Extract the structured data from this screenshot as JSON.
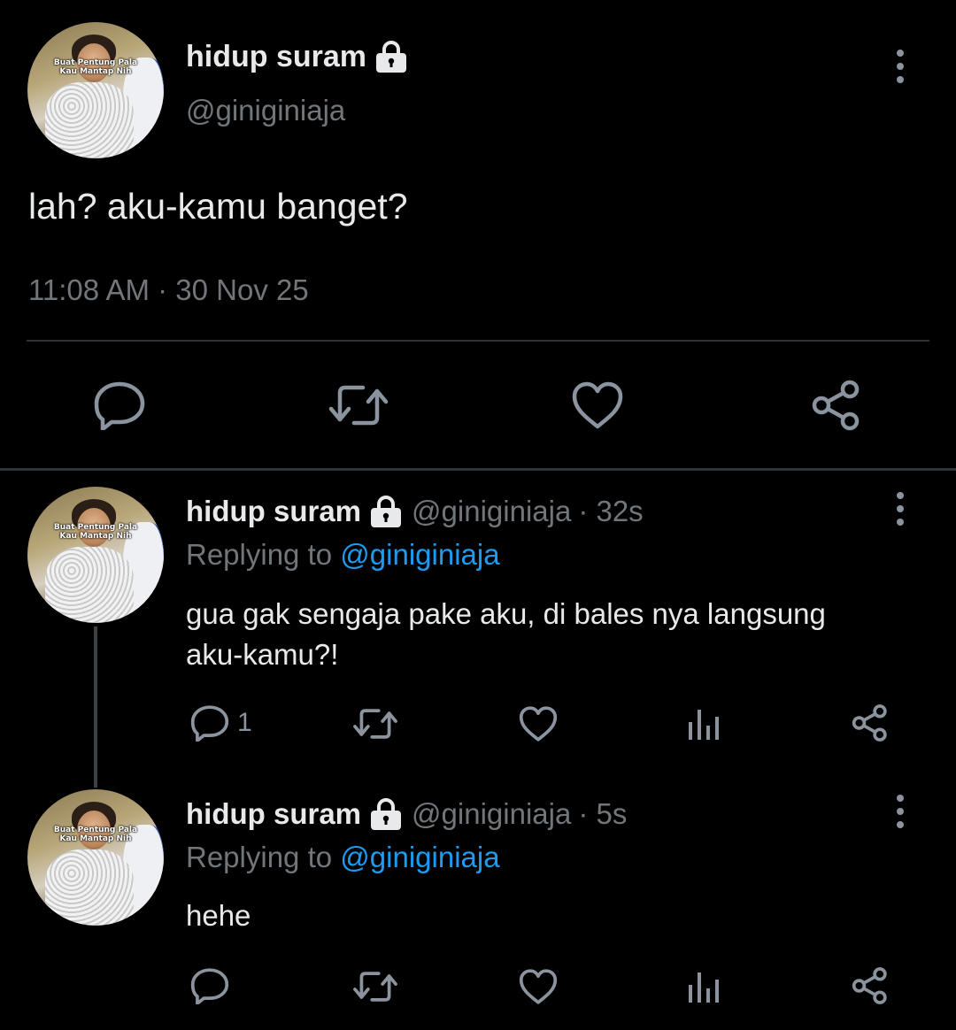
{
  "main_tweet": {
    "display_name": "hidup suram",
    "handle": "@giniginiaja",
    "text": "lah? aku-kamu banget?",
    "timestamp": "11:08 AM · 30 Nov 25",
    "avatar_caption_1": "Buat Pentung Pala",
    "avatar_caption_2": "Kau Mantap Nih",
    "actions": [
      "reply-icon",
      "retweet-icon",
      "like-icon",
      "share-icon"
    ]
  },
  "replies": [
    {
      "display_name": "hidup suram",
      "handle": "@giniginiaja",
      "time": "· 32s",
      "replying_prefix": "Replying to",
      "replying_to": "@giniginiaja",
      "text_line1": "gua gak sengaja pake aku, di bales nya langsung",
      "text_line2": "aku-kamu?!",
      "reply_count": "1",
      "avatar_caption_1": "Buat Pentung Pala",
      "avatar_caption_2": "Kau Mantap Nih"
    },
    {
      "display_name": "hidup suram",
      "handle": "@giniginiaja",
      "time": "· 5s",
      "replying_prefix": "Replying to",
      "replying_to": "@giniginiaja",
      "text_line1": "hehe",
      "reply_count": "",
      "avatar_caption_1": "Buat Pentung Pala",
      "avatar_caption_2": "Kau Mantap Nih"
    }
  ],
  "colors": {
    "background": "#000000",
    "text": "#e7e9ea",
    "muted": "#71767b",
    "link": "#1d9bf0",
    "icon": "#8b949e",
    "divider": "#2f3336"
  }
}
